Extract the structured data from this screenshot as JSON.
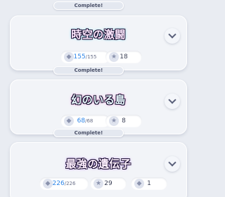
{
  "complete_label": "Complete!",
  "stages": [
    {
      "title": "時空の激闘",
      "progress": "155",
      "total": "155",
      "stars": "18"
    },
    {
      "title": "幻のいる島",
      "progress": "68",
      "total": "68",
      "stars": "8"
    },
    {
      "title": "最強の遺伝子",
      "progress": "226",
      "total": "226",
      "stars": "29",
      "extra": "1"
    }
  ],
  "icons": {
    "progress": "crystal-icon",
    "stars": "star-icon",
    "expand": "chevron-down-icon"
  },
  "colors": {
    "accent": "#2f86e8",
    "background": "#e9ecf2"
  }
}
